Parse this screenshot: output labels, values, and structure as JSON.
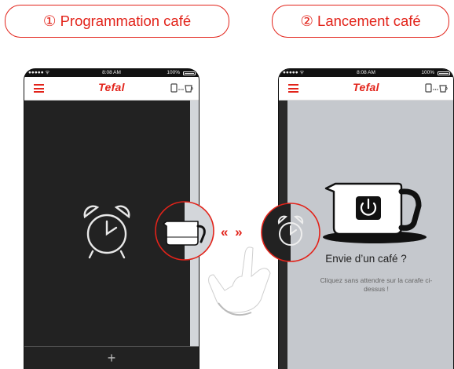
{
  "tabs": [
    {
      "label": "① Programmation café"
    },
    {
      "label": "② Lancement café"
    }
  ],
  "phone_left": {
    "status": {
      "carrier": "●●●●● ᯤ",
      "time": "8:08 AM",
      "battery": "100%"
    },
    "logo": "Tefal",
    "add_symbol": "+"
  },
  "phone_right": {
    "status": {
      "carrier": "●●●●● ᯤ",
      "time": "8:08 AM",
      "battery": "100%"
    },
    "logo": "Tefal",
    "title": "Envie d’un café ?",
    "hint": "Cliquez sans attendre sur la carafe ci-dessus !"
  },
  "between_arrows": "« »",
  "colors": {
    "accent": "#e2231a",
    "dark_bg": "#222222",
    "light_bg": "#c5c8cd"
  },
  "icons": [
    "menu-icon",
    "connection-icon",
    "alarm-clock-icon",
    "carafe-icon",
    "power-icon",
    "hand-pointer-icon"
  ]
}
